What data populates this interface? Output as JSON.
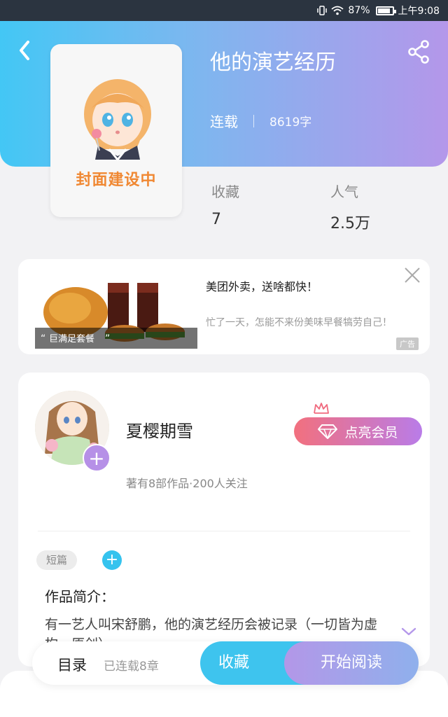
{
  "status_bar": {
    "battery": "87%",
    "battery_level": 0.87,
    "time": "上午9:08"
  },
  "header": {
    "back_icon": "chevron-left-icon",
    "share_icon": "share-icon",
    "title": "他的演艺经历",
    "status": "连载",
    "word_count": "8619字",
    "cover_text": "封面建设中",
    "gradient": [
      "#43c7f5",
      "#b497ea"
    ]
  },
  "stats": [
    {
      "label": "收藏",
      "value": "7"
    },
    {
      "label": "人气",
      "value": "2.5万"
    }
  ],
  "ad": {
    "title": "美团外卖，送啥都快！",
    "description": "忙了一天，怎能不来份美味早餐犒劳自己！",
    "image_caption": "巨满足套餐",
    "tag": "广告",
    "close_icon": "close-icon"
  },
  "author": {
    "name": "夏樱期雪",
    "info": "著有8部作品·200人关注",
    "vip_label": "点亮会员",
    "vip_icon": "diamond-icon",
    "follow_icon": "plus-icon",
    "tag": "短篇",
    "intro_heading": "作品简介：",
    "intro_text": "有一艺人叫宋舒鹏，他的演艺经历会被记录（一切皆为虚构，原创）",
    "expand_icon": "chevron-down-icon"
  },
  "bottom_bar": {
    "toc_label": "目录",
    "chapter_count": "已连载8章",
    "favorite_label": "收藏",
    "read_label": "开始阅读"
  }
}
